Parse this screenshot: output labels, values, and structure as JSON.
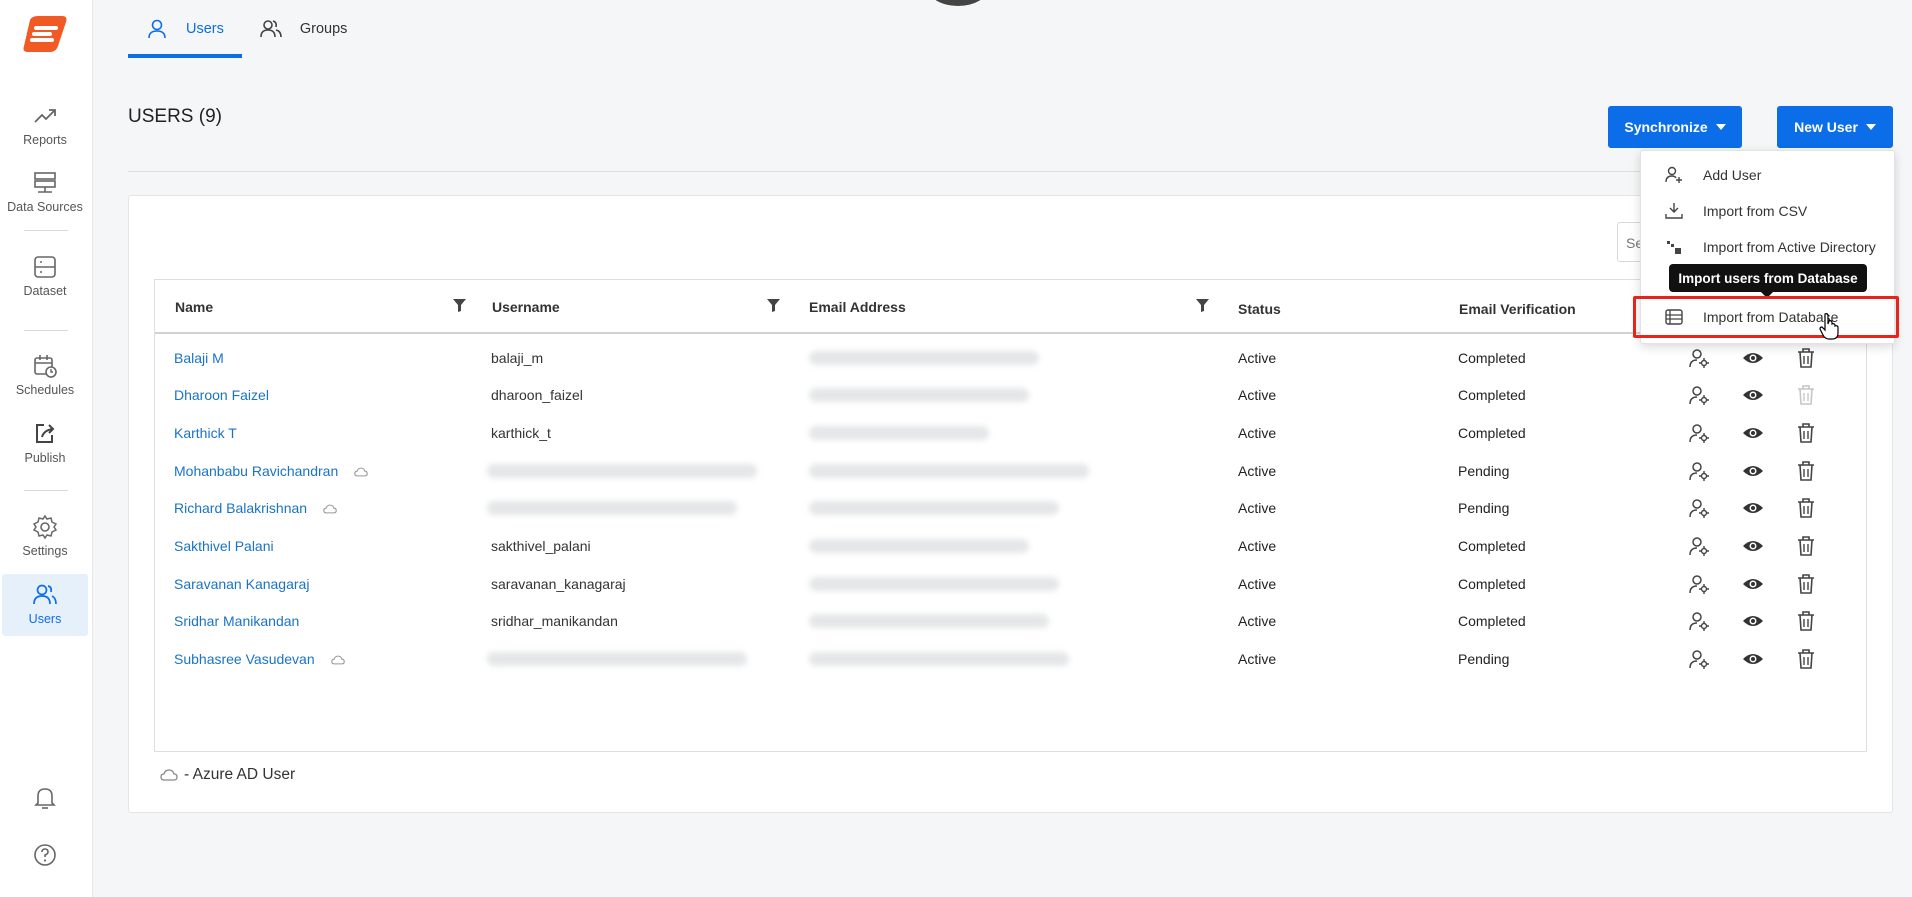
{
  "sidebar": {
    "items": [
      {
        "label": "Reports",
        "icon": "trend-icon"
      },
      {
        "label": "Data Sources",
        "icon": "database-icon"
      },
      {
        "label": "Dataset",
        "icon": "dataset-icon"
      },
      {
        "label": "Schedules",
        "icon": "calendar-clock-icon"
      },
      {
        "label": "Publish",
        "icon": "publish-icon"
      },
      {
        "label": "Settings",
        "icon": "gear-icon"
      },
      {
        "label": "Users",
        "icon": "users-icon",
        "active": true
      }
    ]
  },
  "tabs": [
    {
      "label": "Users",
      "active": true
    },
    {
      "label": "Groups",
      "active": false
    }
  ],
  "page": {
    "title": "USERS (9)",
    "synchronize_label": "Synchronize",
    "new_user_label": "New User",
    "search_placeholder": "Se"
  },
  "table": {
    "columns": [
      "Name",
      "Username",
      "Email Address",
      "Status",
      "Email Verification"
    ],
    "rows": [
      {
        "name": "Balaji M",
        "username": "balaji_m",
        "status": "Active",
        "verification": "Completed",
        "azure": false,
        "delete_disabled": false
      },
      {
        "name": "Dharoon Faizel",
        "username": "dharoon_faizel",
        "status": "Active",
        "verification": "Completed",
        "azure": false,
        "delete_disabled": true
      },
      {
        "name": "Karthick T",
        "username": "karthick_t",
        "status": "Active",
        "verification": "Completed",
        "azure": false,
        "delete_disabled": false
      },
      {
        "name": "Mohanbabu Ravichandran",
        "username": "",
        "status": "Active",
        "verification": "Pending",
        "azure": true,
        "delete_disabled": false
      },
      {
        "name": "Richard Balakrishnan",
        "username": "",
        "status": "Active",
        "verification": "Pending",
        "azure": true,
        "delete_disabled": false
      },
      {
        "name": "Sakthivel Palani",
        "username": "sakthivel_palani",
        "status": "Active",
        "verification": "Completed",
        "azure": false,
        "delete_disabled": false
      },
      {
        "name": "Saravanan Kanagaraj",
        "username": "saravanan_kanagaraj",
        "status": "Active",
        "verification": "Completed",
        "azure": false,
        "delete_disabled": false
      },
      {
        "name": "Sridhar Manikandan",
        "username": "sridhar_manikandan",
        "status": "Active",
        "verification": "Completed",
        "azure": false,
        "delete_disabled": false
      },
      {
        "name": "Subhasree Vasudevan",
        "username": "",
        "status": "Active",
        "verification": "Pending",
        "azure": true,
        "delete_disabled": false
      }
    ]
  },
  "legend": {
    "text": "- Azure AD User"
  },
  "dropdown": {
    "items": [
      {
        "label": "Add User",
        "icon": "add-user-icon"
      },
      {
        "label": "Import from CSV",
        "icon": "download-icon"
      },
      {
        "label": "Import from Active Directory",
        "icon": "windows-icon"
      },
      {
        "label": "Import from Database",
        "icon": "database-list-icon"
      }
    ],
    "tooltip": "Import users from Database"
  },
  "colors": {
    "accent": "#0b6ee8",
    "link": "#1a73c8",
    "highlight": "#e8231a",
    "logo": "#f15a24"
  }
}
